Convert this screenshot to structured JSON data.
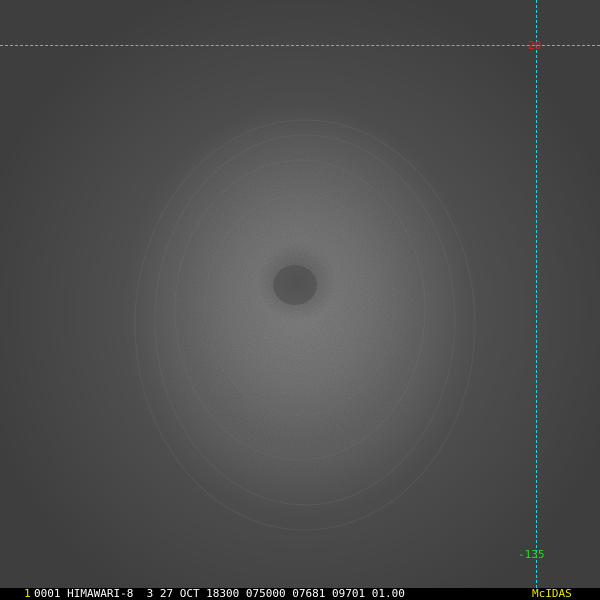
{
  "image": {
    "description_colors": {
      "grid_line": "#18d8e8",
      "latitude_label": "#e02020",
      "longitude_label": "#20e020",
      "frame_number": "#e8e800",
      "status_text": "#ffffff",
      "logo": "#e8e800"
    }
  },
  "grid": {
    "latitude_label": "20",
    "longitude_label": "-135"
  },
  "status_bar": {
    "frame_number": "1",
    "text": "0001 HIMAWARI-8  3 27 OCT 18300 075000 07681 09701 01.00",
    "logo": "McIDAS"
  }
}
